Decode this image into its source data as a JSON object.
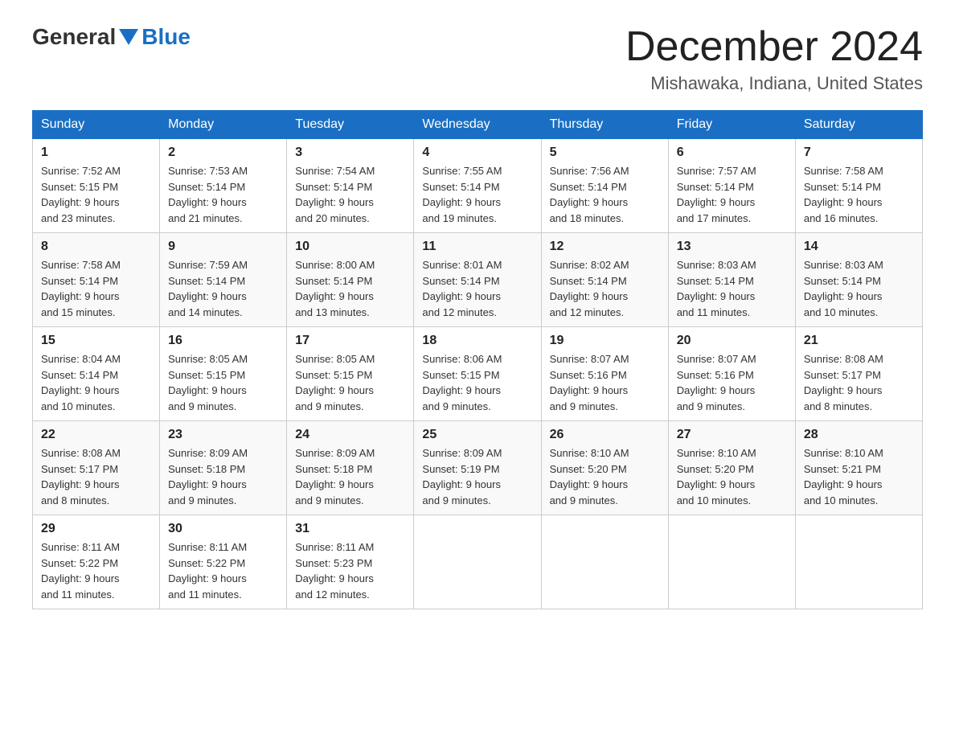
{
  "header": {
    "logo_general": "General",
    "logo_blue": "Blue",
    "month_title": "December 2024",
    "location": "Mishawaka, Indiana, United States"
  },
  "days_of_week": [
    "Sunday",
    "Monday",
    "Tuesday",
    "Wednesday",
    "Thursday",
    "Friday",
    "Saturday"
  ],
  "weeks": [
    [
      {
        "date": "1",
        "sunrise": "7:52 AM",
        "sunset": "5:15 PM",
        "daylight": "9 hours and 23 minutes."
      },
      {
        "date": "2",
        "sunrise": "7:53 AM",
        "sunset": "5:14 PM",
        "daylight": "9 hours and 21 minutes."
      },
      {
        "date": "3",
        "sunrise": "7:54 AM",
        "sunset": "5:14 PM",
        "daylight": "9 hours and 20 minutes."
      },
      {
        "date": "4",
        "sunrise": "7:55 AM",
        "sunset": "5:14 PM",
        "daylight": "9 hours and 19 minutes."
      },
      {
        "date": "5",
        "sunrise": "7:56 AM",
        "sunset": "5:14 PM",
        "daylight": "9 hours and 18 minutes."
      },
      {
        "date": "6",
        "sunrise": "7:57 AM",
        "sunset": "5:14 PM",
        "daylight": "9 hours and 17 minutes."
      },
      {
        "date": "7",
        "sunrise": "7:58 AM",
        "sunset": "5:14 PM",
        "daylight": "9 hours and 16 minutes."
      }
    ],
    [
      {
        "date": "8",
        "sunrise": "7:58 AM",
        "sunset": "5:14 PM",
        "daylight": "9 hours and 15 minutes."
      },
      {
        "date": "9",
        "sunrise": "7:59 AM",
        "sunset": "5:14 PM",
        "daylight": "9 hours and 14 minutes."
      },
      {
        "date": "10",
        "sunrise": "8:00 AM",
        "sunset": "5:14 PM",
        "daylight": "9 hours and 13 minutes."
      },
      {
        "date": "11",
        "sunrise": "8:01 AM",
        "sunset": "5:14 PM",
        "daylight": "9 hours and 12 minutes."
      },
      {
        "date": "12",
        "sunrise": "8:02 AM",
        "sunset": "5:14 PM",
        "daylight": "9 hours and 12 minutes."
      },
      {
        "date": "13",
        "sunrise": "8:03 AM",
        "sunset": "5:14 PM",
        "daylight": "9 hours and 11 minutes."
      },
      {
        "date": "14",
        "sunrise": "8:03 AM",
        "sunset": "5:14 PM",
        "daylight": "9 hours and 10 minutes."
      }
    ],
    [
      {
        "date": "15",
        "sunrise": "8:04 AM",
        "sunset": "5:14 PM",
        "daylight": "9 hours and 10 minutes."
      },
      {
        "date": "16",
        "sunrise": "8:05 AM",
        "sunset": "5:15 PM",
        "daylight": "9 hours and 9 minutes."
      },
      {
        "date": "17",
        "sunrise": "8:05 AM",
        "sunset": "5:15 PM",
        "daylight": "9 hours and 9 minutes."
      },
      {
        "date": "18",
        "sunrise": "8:06 AM",
        "sunset": "5:15 PM",
        "daylight": "9 hours and 9 minutes."
      },
      {
        "date": "19",
        "sunrise": "8:07 AM",
        "sunset": "5:16 PM",
        "daylight": "9 hours and 9 minutes."
      },
      {
        "date": "20",
        "sunrise": "8:07 AM",
        "sunset": "5:16 PM",
        "daylight": "9 hours and 9 minutes."
      },
      {
        "date": "21",
        "sunrise": "8:08 AM",
        "sunset": "5:17 PM",
        "daylight": "9 hours and 8 minutes."
      }
    ],
    [
      {
        "date": "22",
        "sunrise": "8:08 AM",
        "sunset": "5:17 PM",
        "daylight": "9 hours and 8 minutes."
      },
      {
        "date": "23",
        "sunrise": "8:09 AM",
        "sunset": "5:18 PM",
        "daylight": "9 hours and 9 minutes."
      },
      {
        "date": "24",
        "sunrise": "8:09 AM",
        "sunset": "5:18 PM",
        "daylight": "9 hours and 9 minutes."
      },
      {
        "date": "25",
        "sunrise": "8:09 AM",
        "sunset": "5:19 PM",
        "daylight": "9 hours and 9 minutes."
      },
      {
        "date": "26",
        "sunrise": "8:10 AM",
        "sunset": "5:20 PM",
        "daylight": "9 hours and 9 minutes."
      },
      {
        "date": "27",
        "sunrise": "8:10 AM",
        "sunset": "5:20 PM",
        "daylight": "9 hours and 10 minutes."
      },
      {
        "date": "28",
        "sunrise": "8:10 AM",
        "sunset": "5:21 PM",
        "daylight": "9 hours and 10 minutes."
      }
    ],
    [
      {
        "date": "29",
        "sunrise": "8:11 AM",
        "sunset": "5:22 PM",
        "daylight": "9 hours and 11 minutes."
      },
      {
        "date": "30",
        "sunrise": "8:11 AM",
        "sunset": "5:22 PM",
        "daylight": "9 hours and 11 minutes."
      },
      {
        "date": "31",
        "sunrise": "8:11 AM",
        "sunset": "5:23 PM",
        "daylight": "9 hours and 12 minutes."
      },
      null,
      null,
      null,
      null
    ]
  ],
  "labels": {
    "sunrise": "Sunrise:",
    "sunset": "Sunset:",
    "daylight": "Daylight:"
  }
}
